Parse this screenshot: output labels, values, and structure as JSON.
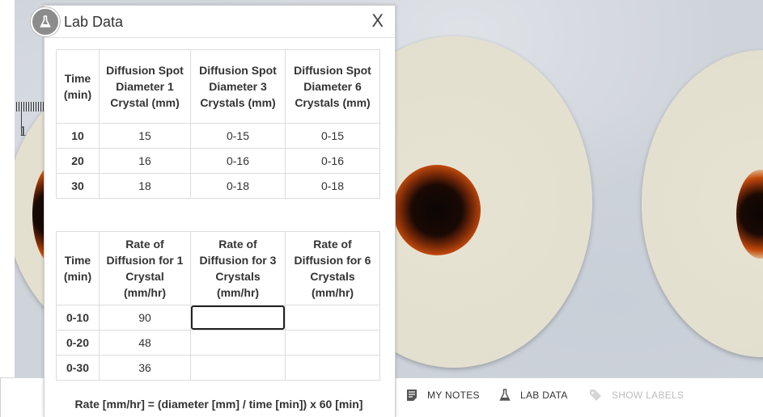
{
  "panel": {
    "title": "Lab Data",
    "close_label": "X",
    "badge_icon": "flask-icon"
  },
  "table1": {
    "headers": [
      "Time (min)",
      "Diffusion Spot Diameter 1 Crystal (mm)",
      "Diffusion Spot Diameter 3 Crystals (mm)",
      "Diffusion Spot Diameter 6 Crystals (mm)"
    ],
    "rows": [
      [
        "10",
        "15",
        "0-15",
        "0-15"
      ],
      [
        "20",
        "16",
        "0-16",
        "0-16"
      ],
      [
        "30",
        "18",
        "0-18",
        "0-18"
      ]
    ]
  },
  "table2": {
    "headers": [
      "Time (min)",
      "Rate of Diffusion for 1 Crystal (mm/hr)",
      "Rate of Diffusion for 3 Crystals (mm/hr)",
      "Rate of Diffusion for 6 Crystals (mm/hr)"
    ],
    "rows": [
      [
        "0-10",
        "90",
        "",
        ""
      ],
      [
        "0-20",
        "48",
        "",
        ""
      ],
      [
        "0-30",
        "36",
        "",
        ""
      ]
    ]
  },
  "formula": "Rate [mm/hr] = (diameter [mm] / time [min]) x 60 [min]",
  "toolbar": {
    "my_notes": "MY NOTES",
    "lab_data": "LAB DATA",
    "show_labels": "SHOW LABELS"
  },
  "scene": {
    "ruler_number": "1"
  },
  "colors": {
    "panel_border": "#cfcfcf",
    "active_input_border": "#222222",
    "disabled_text": "#bdbdbd"
  }
}
